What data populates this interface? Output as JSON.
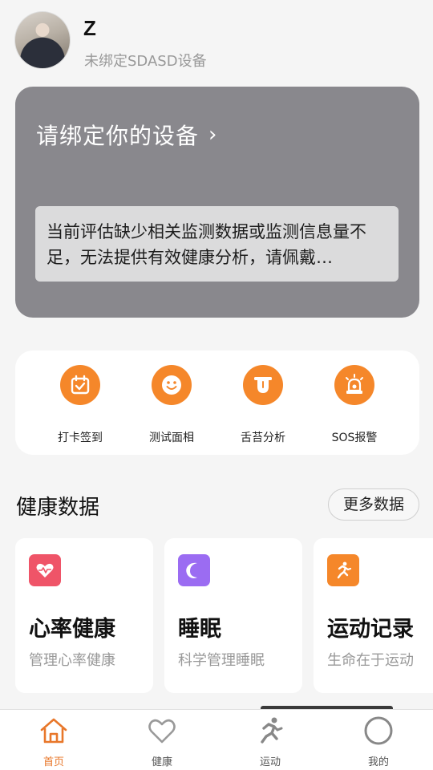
{
  "user": {
    "name": "Z",
    "device_status": "未绑定SDASD设备"
  },
  "device_card": {
    "bind_label": "请绑定你的设备",
    "chevron": "›",
    "notice_line1": "当前评估缺少相关监测数据或监测信息量不",
    "notice_line2": "足，无法提供有效健康分析，请佩戴…"
  },
  "quick_actions": [
    {
      "label": "打卡签到",
      "icon": "calendar-check-icon"
    },
    {
      "label": "测试面相",
      "icon": "smiley-face-icon"
    },
    {
      "label": "舌苔分析",
      "icon": "tongue-icon"
    },
    {
      "label": "SOS报警",
      "icon": "alarm-siren-icon"
    }
  ],
  "health_section": {
    "title": "健康数据",
    "more_label": "更多数据"
  },
  "health_cards": [
    {
      "title": "心率健康",
      "subtitle": "管理心率健康",
      "icon": "heart-pulse-icon",
      "color": "#ef5468"
    },
    {
      "title": "睡眠",
      "subtitle": "科学管理睡眠",
      "icon": "moon-icon",
      "color": "#9b6cf2"
    },
    {
      "title": "运动记录",
      "subtitle": "生命在于运动",
      "icon": "running-icon",
      "color": "#f5872a"
    }
  ],
  "bottom_nav": [
    {
      "label": "首页",
      "icon": "home-icon",
      "active": true
    },
    {
      "label": "健康",
      "icon": "heart-outline-icon",
      "active": false
    },
    {
      "label": "运动",
      "icon": "runner-icon",
      "active": false
    },
    {
      "label": "我的",
      "icon": "profile-circle-icon",
      "active": false
    }
  ],
  "colors": {
    "accent": "#f5872a",
    "card_gray": "#89888d",
    "nav_active": "#e8772a"
  }
}
